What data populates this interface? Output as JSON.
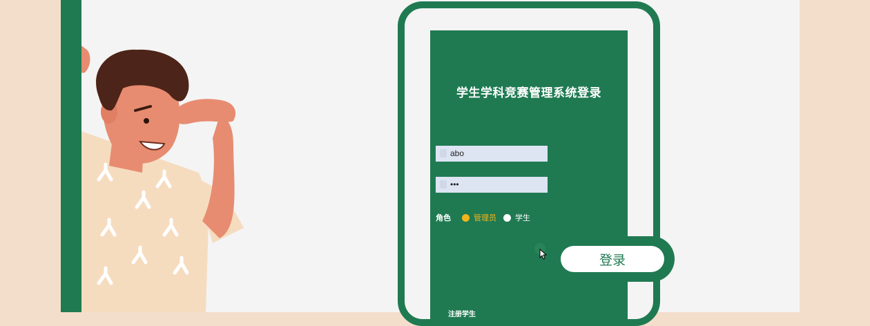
{
  "login": {
    "title": "学生学科竞赛管理系统登录",
    "username_value": "abo",
    "password_value": "•••",
    "role_label": "角色",
    "roles": [
      "管理员",
      "学生"
    ],
    "selected_role": "管理员",
    "submit_label": "登录",
    "register_link": "注册学生"
  },
  "colors": {
    "brand_green": "#1f7a52",
    "page_bg": "#f3decb",
    "stage_bg": "#f4f4f4",
    "radio_selected": "#f1b51c",
    "input_bg": "#dde5f3",
    "skin": "#e78c70",
    "hair": "#4d2419",
    "shirt": "#f6dcbf"
  },
  "icons": {
    "cursor": "mouse-pointer-icon",
    "illustration": "man-peeking-illustration"
  }
}
